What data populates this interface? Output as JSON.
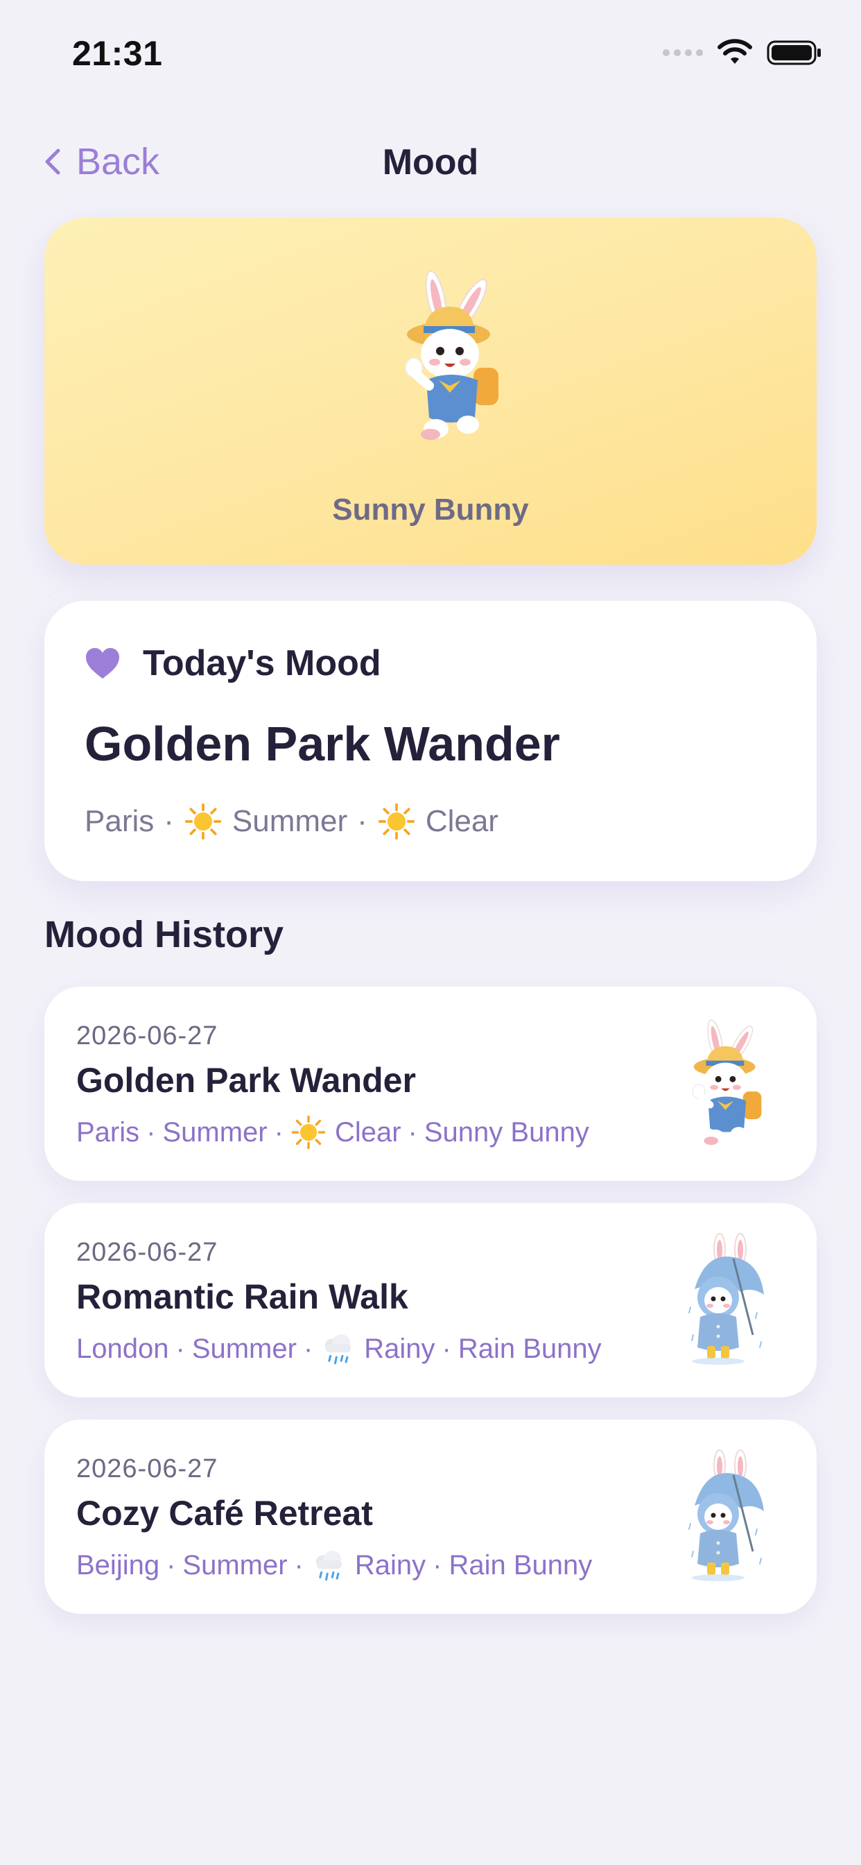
{
  "status_bar": {
    "time": "21:31"
  },
  "nav": {
    "back_label": "Back",
    "title": "Mood"
  },
  "hero": {
    "character_name": "Sunny Bunny"
  },
  "today": {
    "label": "Today's Mood",
    "title": "Golden Park Wander",
    "city": "Paris",
    "season": "Summer",
    "weather": "Clear",
    "separator": "·"
  },
  "history": {
    "section_title": "Mood History",
    "items": [
      {
        "date": "2026-06-27",
        "title": "Golden Park Wander",
        "city": "Paris",
        "season": "Summer",
        "weather": "Clear",
        "character": "Sunny Bunny"
      },
      {
        "date": "2026-06-27",
        "title": "Romantic Rain Walk",
        "city": "London",
        "season": "Summer",
        "weather": "Rainy",
        "character": "Rain Bunny"
      },
      {
        "date": "2026-06-27",
        "title": "Cozy Café Retreat",
        "city": "Beijing",
        "season": "Summer",
        "weather": "Rainy",
        "character": "Rain Bunny"
      }
    ]
  },
  "colors": {
    "accent": "#9a7fd6",
    "heart": "#9c7fd8",
    "background": "#f2f1f8",
    "hero_gradient_start": "#fdf0b6",
    "hero_gradient_end": "#fedf8a"
  }
}
